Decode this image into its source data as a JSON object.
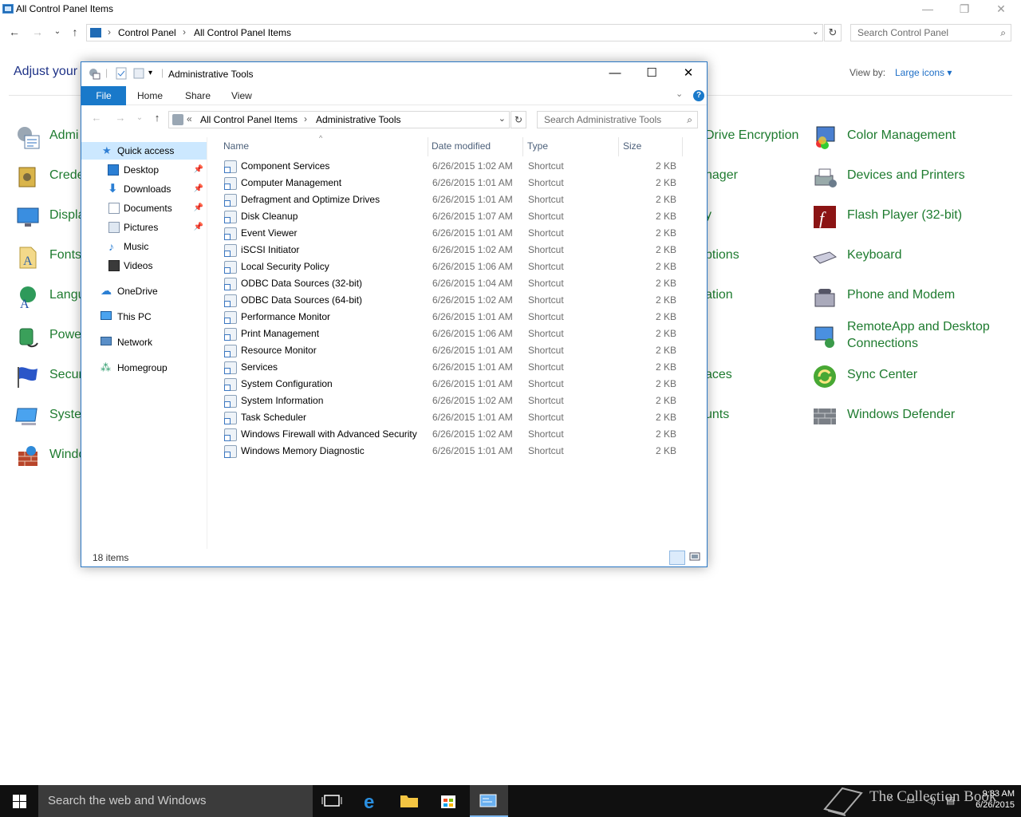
{
  "cp": {
    "title": "All Control Panel Items",
    "address": [
      "Control Panel",
      "All Control Panel Items"
    ],
    "search_placeholder": "Search Control Panel",
    "heading": "Adjust your",
    "view_by_label": "View by:",
    "view_by_value": "Large icons",
    "left_items": [
      "Admi",
      "Crede",
      "Displa",
      "Fonts",
      "Langu",
      "Powe",
      "Secur",
      "Syster",
      "Windo"
    ],
    "middle_items": [
      "Drive Encryption",
      "nager",
      "y",
      "ptions",
      "ation",
      "aces",
      "unts"
    ],
    "right_items": [
      "Color Management",
      "Devices and Printers",
      "Flash Player (32-bit)",
      "Keyboard",
      "Phone and Modem",
      "RemoteApp and Desktop",
      "Connections",
      "Sync Center",
      "Windows Defender"
    ]
  },
  "at": {
    "title": "Administrative Tools",
    "tabs": {
      "file": "File",
      "home": "Home",
      "share": "Share",
      "view": "View"
    },
    "address": [
      "All Control Panel Items",
      "Administrative Tools"
    ],
    "address_prefix": "«",
    "search_placeholder": "Search Administrative Tools",
    "nav": {
      "quick_access": "Quick access",
      "desktop": "Desktop",
      "downloads": "Downloads",
      "documents": "Documents",
      "pictures": "Pictures",
      "music": "Music",
      "videos": "Videos",
      "onedrive": "OneDrive",
      "thispc": "This PC",
      "network": "Network",
      "homegroup": "Homegroup"
    },
    "columns": {
      "name": "Name",
      "date": "Date modified",
      "type": "Type",
      "size": "Size"
    },
    "files": [
      {
        "name": "Component Services",
        "date": "6/26/2015 1:02 AM",
        "type": "Shortcut",
        "size": "2 KB"
      },
      {
        "name": "Computer Management",
        "date": "6/26/2015 1:01 AM",
        "type": "Shortcut",
        "size": "2 KB"
      },
      {
        "name": "Defragment and Optimize Drives",
        "date": "6/26/2015 1:01 AM",
        "type": "Shortcut",
        "size": "2 KB"
      },
      {
        "name": "Disk Cleanup",
        "date": "6/26/2015 1:07 AM",
        "type": "Shortcut",
        "size": "2 KB"
      },
      {
        "name": "Event Viewer",
        "date": "6/26/2015 1:01 AM",
        "type": "Shortcut",
        "size": "2 KB"
      },
      {
        "name": "iSCSI Initiator",
        "date": "6/26/2015 1:02 AM",
        "type": "Shortcut",
        "size": "2 KB"
      },
      {
        "name": "Local Security Policy",
        "date": "6/26/2015 1:06 AM",
        "type": "Shortcut",
        "size": "2 KB"
      },
      {
        "name": "ODBC Data Sources (32-bit)",
        "date": "6/26/2015 1:04 AM",
        "type": "Shortcut",
        "size": "2 KB"
      },
      {
        "name": "ODBC Data Sources (64-bit)",
        "date": "6/26/2015 1:02 AM",
        "type": "Shortcut",
        "size": "2 KB"
      },
      {
        "name": "Performance Monitor",
        "date": "6/26/2015 1:01 AM",
        "type": "Shortcut",
        "size": "2 KB"
      },
      {
        "name": "Print Management",
        "date": "6/26/2015 1:06 AM",
        "type": "Shortcut",
        "size": "2 KB"
      },
      {
        "name": "Resource Monitor",
        "date": "6/26/2015 1:01 AM",
        "type": "Shortcut",
        "size": "2 KB"
      },
      {
        "name": "Services",
        "date": "6/26/2015 1:01 AM",
        "type": "Shortcut",
        "size": "2 KB"
      },
      {
        "name": "System Configuration",
        "date": "6/26/2015 1:01 AM",
        "type": "Shortcut",
        "size": "2 KB"
      },
      {
        "name": "System Information",
        "date": "6/26/2015 1:02 AM",
        "type": "Shortcut",
        "size": "2 KB"
      },
      {
        "name": "Task Scheduler",
        "date": "6/26/2015 1:01 AM",
        "type": "Shortcut",
        "size": "2 KB"
      },
      {
        "name": "Windows Firewall with Advanced Security",
        "date": "6/26/2015 1:02 AM",
        "type": "Shortcut",
        "size": "2 KB"
      },
      {
        "name": "Windows Memory Diagnostic",
        "date": "6/26/2015 1:01 AM",
        "type": "Shortcut",
        "size": "2 KB"
      }
    ],
    "item_count": "18 items"
  },
  "taskbar": {
    "search_placeholder": "Search the web and Windows",
    "watermark": "The Collection Book",
    "time": "9:33 AM",
    "date": "6/26/2015"
  },
  "colors": {
    "accent": "#1979ca",
    "cp_link": "#1e7b2f",
    "heading": "#1e3287",
    "taskbar": "#101010"
  }
}
